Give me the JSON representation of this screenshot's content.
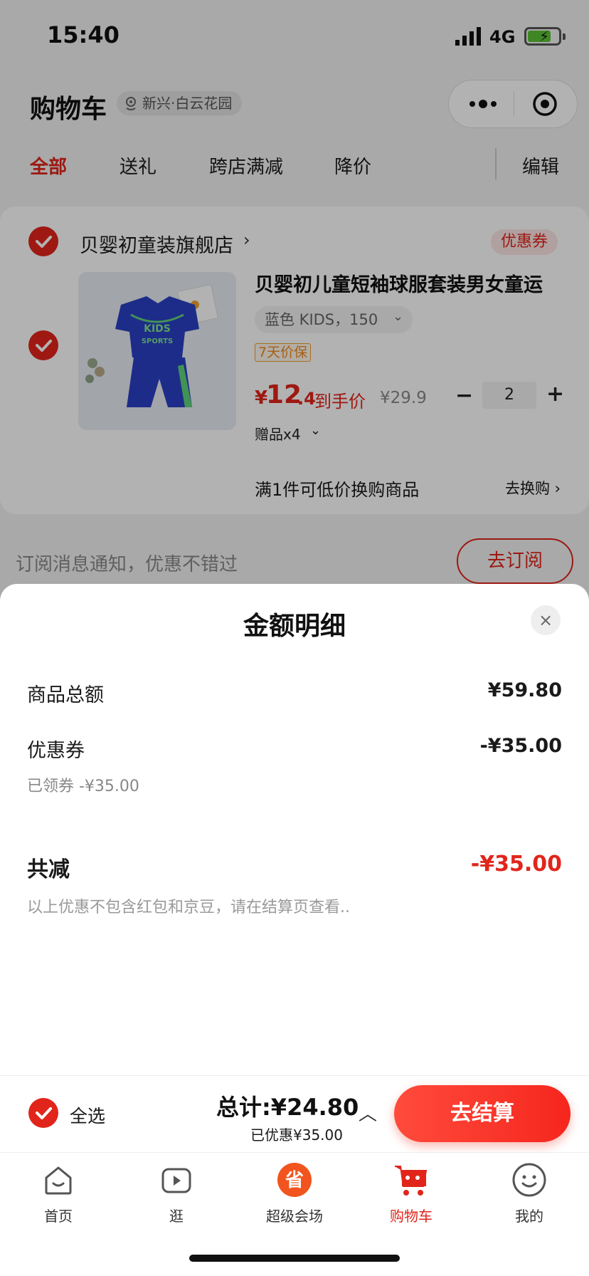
{
  "status_bar": {
    "time": "15:40",
    "network": "4G"
  },
  "header": {
    "title": "购物车",
    "location": "新兴·白云花园"
  },
  "tabs": [
    {
      "label": "全部",
      "active": true
    },
    {
      "label": "送礼",
      "active": false
    },
    {
      "label": "跨店满减",
      "active": false
    },
    {
      "label": "降价",
      "active": false
    }
  ],
  "edit_label": "编辑",
  "shop": {
    "name": "贝婴初童装旗舰店",
    "chevron": "›",
    "coupon_label": "优惠券"
  },
  "product": {
    "title": "贝婴初儿童短袖球服套装男女童运",
    "spec": "蓝色 KIDS，150",
    "guarantee": "7天价保",
    "price_symbol": "¥",
    "price_int": "12",
    "price_dec": ".4",
    "price_label": "到手价",
    "original_price": "¥29.9",
    "quantity": "2",
    "gift": "赠品x4",
    "image_text_1": "KIDS",
    "image_text_2": "SPORTS"
  },
  "swap": {
    "text": "满1件可低价换购商品",
    "link": "去换购 ›"
  },
  "subscribe": {
    "text": "订阅消息通知，优惠不错过",
    "button": "去订阅"
  },
  "sheet": {
    "title": "金额明细",
    "close": "×",
    "rows": [
      {
        "label": "商品总额",
        "value": "¥59.80"
      },
      {
        "label": "优惠券",
        "value": "-¥35.00",
        "note": "已领券 -¥35.00"
      }
    ],
    "total_label": "共减",
    "total_value": "-¥35.00",
    "footnote": "以上优惠不包含红包和京豆，请在结算页查看.."
  },
  "checkout": {
    "select_all": "全选",
    "total": "总计:¥24.80",
    "saved": "已优惠¥35.00",
    "caret": "︿",
    "pay_button": "去结算"
  },
  "tabbar": [
    {
      "label": "首页",
      "icon": "home-icon",
      "active": false
    },
    {
      "label": "逛",
      "icon": "video-play-icon",
      "active": false
    },
    {
      "label": "超级会场",
      "icon": "super-venue-icon",
      "active": false
    },
    {
      "label": "购物车",
      "icon": "cart-icon",
      "active": true
    },
    {
      "label": "我的",
      "icon": "profile-smile-icon",
      "active": false
    }
  ],
  "colors": {
    "accent": "#e1251b",
    "guarantee": "#f0891d"
  }
}
